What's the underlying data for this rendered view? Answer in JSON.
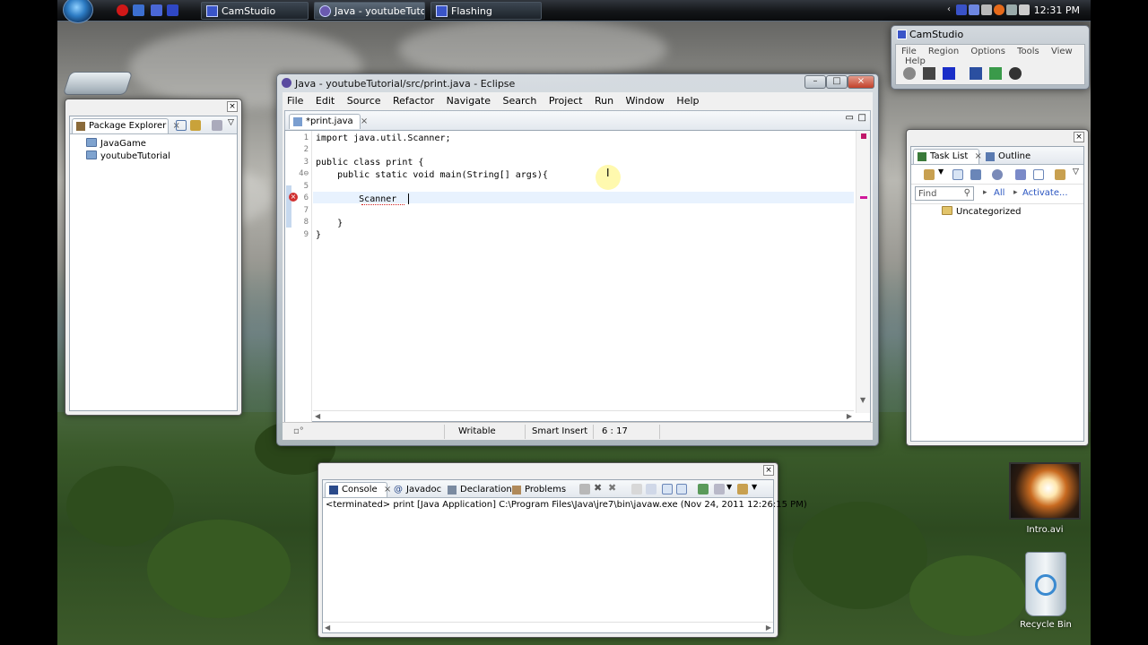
{
  "taskbar": {
    "buttons": [
      {
        "label": "CamStudio",
        "active": false
      },
      {
        "label": "Java - youtubeTutor...",
        "active": true
      },
      {
        "label": "Flashing",
        "active": false
      }
    ],
    "clock": "12:31 PM"
  },
  "desktop": {
    "icons": [
      {
        "label": "Intro.avi",
        "icon": "video-file-icon"
      },
      {
        "label": "Recycle Bin",
        "icon": "recycle-bin-icon"
      }
    ]
  },
  "camstudio": {
    "title": "CamStudio",
    "menu": [
      "File",
      "Region",
      "Options",
      "Tools",
      "View",
      "Help"
    ]
  },
  "eclipse": {
    "title": "Java - youtubeTutorial/src/print.java - Eclipse",
    "menu": [
      "File",
      "Edit",
      "Source",
      "Refactor",
      "Navigate",
      "Search",
      "Project",
      "Run",
      "Window",
      "Help"
    ],
    "editor_tab": "*print.java",
    "lines": [
      {
        "num": "1",
        "text": "import java.util.Scanner;"
      },
      {
        "num": "2",
        "text": ""
      },
      {
        "num": "3",
        "text": "public class print {"
      },
      {
        "num": "4⊖",
        "text": "    public static void main(String[] args){"
      },
      {
        "num": "5",
        "text": ""
      },
      {
        "num": "6",
        "text": "        Scanner "
      },
      {
        "num": "7",
        "text": ""
      },
      {
        "num": "8",
        "text": "    }"
      },
      {
        "num": "9",
        "text": "}"
      }
    ],
    "status": {
      "writable": "Writable",
      "insert_mode": "Smart Insert",
      "position": "6 : 17"
    }
  },
  "package_explorer": {
    "title": "Package Explorer",
    "projects": [
      "JavaGame",
      "youtubeTutorial"
    ]
  },
  "task_list": {
    "tabs": [
      "Task List",
      "Outline"
    ],
    "find_placeholder": "Find",
    "all_label": "All",
    "activate_label": "Activate...",
    "category": "Uncategorized"
  },
  "console": {
    "tabs": [
      "Console",
      "Javadoc",
      "Declaration",
      "Problems"
    ],
    "output": "<terminated> print [Java Application] C:\\Program Files\\Java\\jre7\\bin\\javaw.exe (Nov 24, 2011 12:26:15 PM)"
  }
}
